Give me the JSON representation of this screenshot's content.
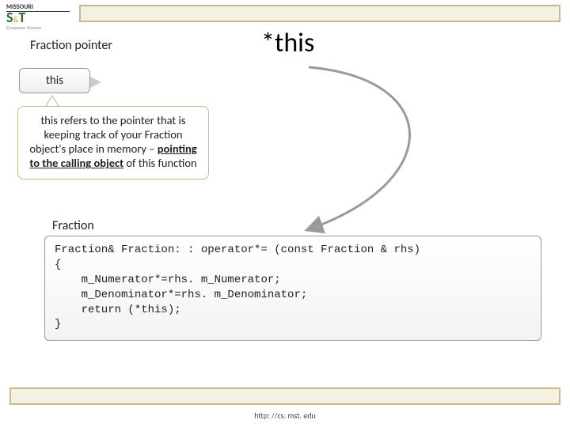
{
  "logo": {
    "line1": "MISSOURI",
    "st": "S",
    "amp": "&",
    "t": "T",
    "sub": "Computer Science"
  },
  "title": "*this",
  "subtitle": "Fraction pointer",
  "this_box": "this",
  "explain": {
    "pre": "this refers to the pointer that is keeping track of your Fraction object's place in memory – ",
    "bold1": "pointing to the calling object",
    "post": " of this function"
  },
  "fraction_label": "Fraction",
  "code": "Fraction& Fraction: : operator*= (const Fraction & rhs)\n{\n    m_Numerator*=rhs. m_Numerator;\n    m_Denominator*=rhs. m_Denominator;\n    return (*this);\n}",
  "footer": "http: //cs. mst. edu"
}
